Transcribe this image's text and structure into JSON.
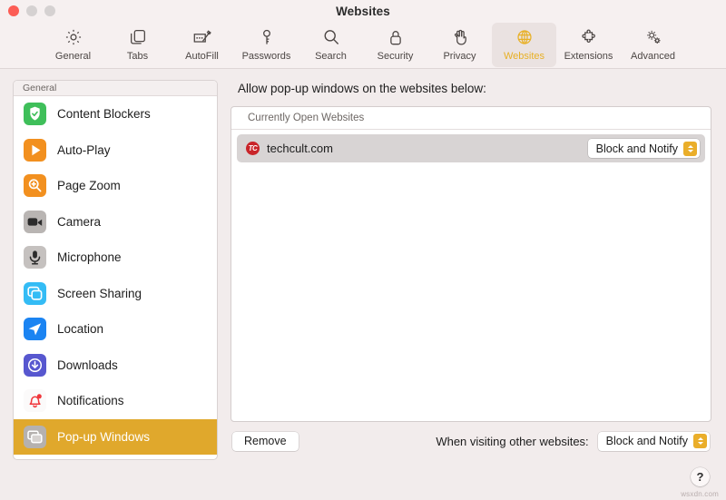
{
  "window": {
    "title": "Websites",
    "traffic_lights": [
      "close",
      "minimize",
      "zoom"
    ]
  },
  "toolbar": {
    "items": [
      {
        "label": "General",
        "icon": "gear-icon",
        "selected": false
      },
      {
        "label": "Tabs",
        "icon": "tabs-icon",
        "selected": false
      },
      {
        "label": "AutoFill",
        "icon": "autofill-icon",
        "selected": false
      },
      {
        "label": "Passwords",
        "icon": "key-icon",
        "selected": false
      },
      {
        "label": "Search",
        "icon": "search-icon",
        "selected": false
      },
      {
        "label": "Security",
        "icon": "lock-icon",
        "selected": false
      },
      {
        "label": "Privacy",
        "icon": "hand-icon",
        "selected": false
      },
      {
        "label": "Websites",
        "icon": "globe-icon",
        "selected": true
      },
      {
        "label": "Extensions",
        "icon": "puzzle-icon",
        "selected": false
      },
      {
        "label": "Advanced",
        "icon": "gears-icon",
        "selected": false
      }
    ]
  },
  "sidebar": {
    "header": "General",
    "items": [
      {
        "label": "Content Blockers",
        "icon": "shield-check-icon",
        "selected": false
      },
      {
        "label": "Auto-Play",
        "icon": "play-icon",
        "selected": false
      },
      {
        "label": "Page Zoom",
        "icon": "zoom-in-icon",
        "selected": false
      },
      {
        "label": "Camera",
        "icon": "camera-icon",
        "selected": false
      },
      {
        "label": "Microphone",
        "icon": "microphone-icon",
        "selected": false
      },
      {
        "label": "Screen Sharing",
        "icon": "screen-share-icon",
        "selected": false
      },
      {
        "label": "Location",
        "icon": "location-arrow-icon",
        "selected": false
      },
      {
        "label": "Downloads",
        "icon": "download-icon",
        "selected": false
      },
      {
        "label": "Notifications",
        "icon": "bell-icon",
        "selected": false
      },
      {
        "label": "Pop-up Windows",
        "icon": "windows-icon",
        "selected": true
      }
    ]
  },
  "main": {
    "heading": "Allow pop-up windows on the websites below:",
    "table": {
      "section_header": "Currently Open Websites",
      "rows": [
        {
          "site": "techcult.com",
          "favicon_text": "TC",
          "setting": "Block and Notify"
        }
      ]
    },
    "footer": {
      "remove_label": "Remove",
      "other_websites_label": "When visiting other websites:",
      "other_websites_value": "Block and Notify"
    }
  },
  "bottom": {
    "help_label": "?",
    "watermark": "wsxdn.com"
  },
  "colors": {
    "accent_selected": "#e0a82c",
    "stepper": "#eaae2a",
    "window_bg": "#f2ecec",
    "toolbar_bg": "#f6f0f0",
    "favicon_red": "#c9252a"
  }
}
